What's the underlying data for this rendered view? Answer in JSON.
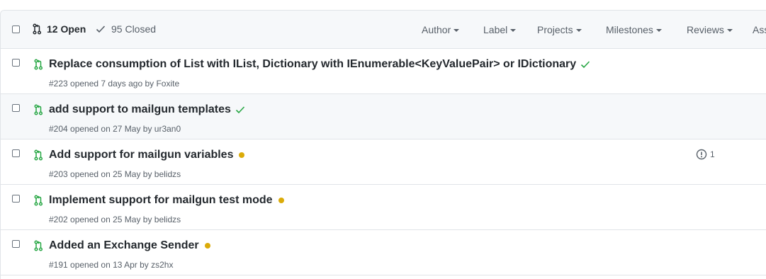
{
  "header": {
    "open_label": "12 Open",
    "closed_label": "95 Closed",
    "filters": [
      "Author",
      "Label",
      "Projects",
      "Milestones",
      "Reviews",
      "Ass"
    ]
  },
  "colors": {
    "open_green": "#28a745",
    "pending_yellow": "#dbab09",
    "muted": "#586069"
  },
  "rows": [
    {
      "title": "Replace consumption of List with IList, Dictionary with IEnumerable<KeyValuePair> or IDictionary",
      "meta": "#223 opened 7 days ago by Foxite",
      "status": "success"
    },
    {
      "title": "add support to mailgun templates",
      "meta": "#204 opened on 27 May by ur3an0",
      "status": "success"
    },
    {
      "title": "Add support for mailgun variables",
      "meta": "#203 opened on 25 May by belidzs",
      "status": "pending",
      "linked_issues": "1"
    },
    {
      "title": "Implement support for mailgun test mode",
      "meta": "#202 opened on 25 May by belidzs",
      "status": "pending"
    },
    {
      "title": "Added an Exchange Sender",
      "meta": "#191 opened on 13 Apr by zs2hx",
      "status": "pending"
    }
  ]
}
